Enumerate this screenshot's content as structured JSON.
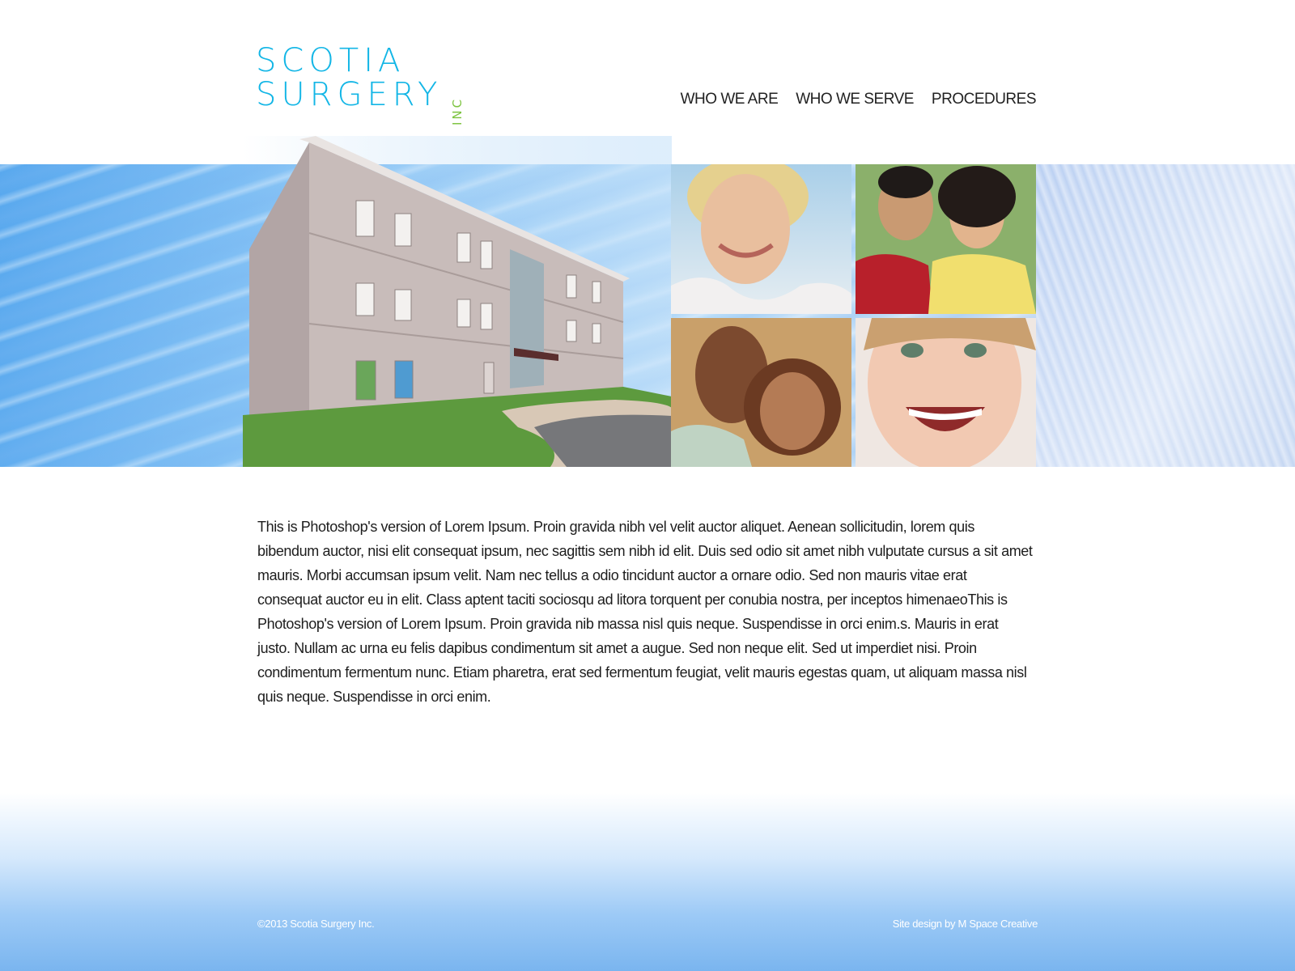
{
  "brand": {
    "line1": "SCOTIA",
    "line2": "SURGERY",
    "suffix": "INC"
  },
  "nav": {
    "items": [
      "WHO WE ARE",
      "WHO WE SERVE",
      "PROCEDURES"
    ]
  },
  "content": {
    "body": "This is Photoshop's version of Lorem Ipsum. Proin gravida nibh vel velit auctor aliquet. Aenean sollicitudin, lorem quis bibendum auctor, nisi elit consequat ipsum, nec sagittis sem nibh id elit. Duis sed odio sit amet nibh vulputate cursus a sit amet mauris. Morbi accumsan ipsum velit. Nam nec tellus a odio tincidunt auctor a ornare odio. Sed non  mauris vitae erat consequat auctor eu in elit. Class aptent taciti sociosqu ad litora torquent per conubia nostra, per inceptos himenaeoThis is Photoshop's version  of Lorem Ipsum. Proin gravida nib massa nisl quis neque. Suspendisse in orci enim.s. Mauris in erat justo. Nullam ac urna eu felis dapibus condimentum sit amet a augue. Sed non neque elit. Sed ut imperdiet nisi. Proin condimentum fermentum nunc. Etiam pharetra, erat sed fermentum feugiat, velit mauris egestas quam, ut aliquam massa nisl quis neque. Suspendisse in orci enim."
  },
  "footer": {
    "copyright": "©2013 Scotia Surgery Inc.",
    "credit": "Site design by M Space Creative"
  },
  "colors": {
    "brand_blue": "#13b6e6",
    "brand_green": "#7cc33f"
  }
}
